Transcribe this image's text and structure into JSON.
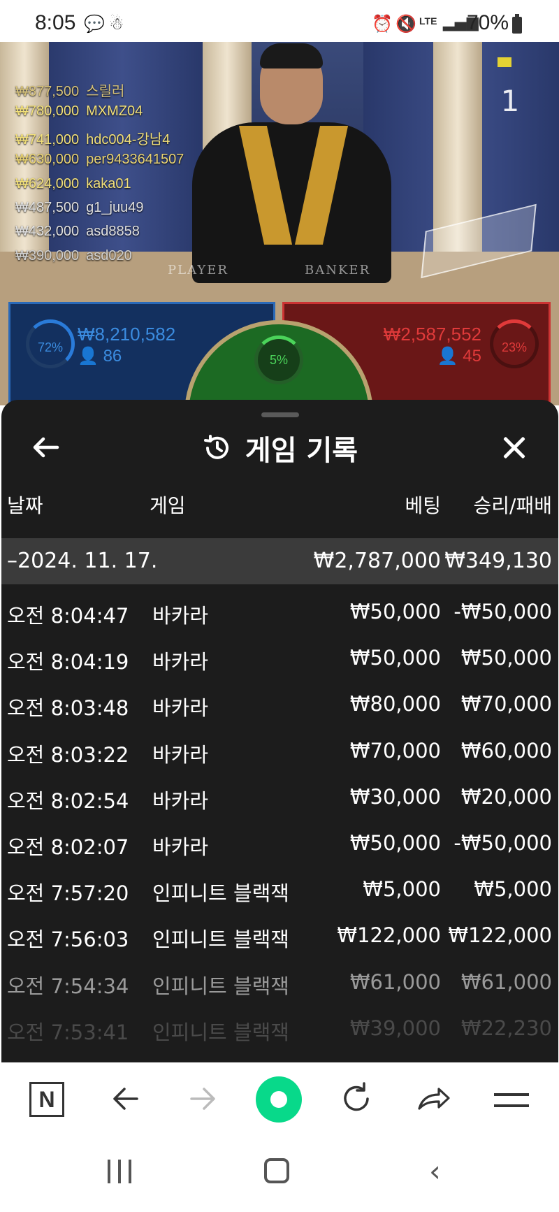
{
  "status_bar": {
    "time": "8:05",
    "battery": "70%",
    "icons": [
      "messenger-icon",
      "snapchat-icon",
      "alarm-icon",
      "mute-icon",
      "lte-icon",
      "signal-icon",
      "battery-icon"
    ]
  },
  "video": {
    "round_number": "1",
    "table_labels": {
      "player": "PLAYER",
      "banker": "BANKER"
    },
    "winners": [
      {
        "amount": "₩877,500",
        "name": "스릴러",
        "color": "#d6c27a"
      },
      {
        "amount": "₩780,000",
        "name": "MXMZ04",
        "color": "#f2e07a"
      },
      {
        "amount": "₩741,000",
        "name": "hdc004-강남4",
        "color": "#f2e07a"
      },
      {
        "amount": "₩630,000",
        "name": "per9433641507",
        "color": "#e8d272"
      },
      {
        "amount": "₩624,000",
        "name": "kaka01",
        "color": "#f2e07a"
      },
      {
        "amount": "₩487,500",
        "name": "g1_juu49",
        "color": "#e0e0e0"
      },
      {
        "amount": "₩432,000",
        "name": "asd8858",
        "color": "#e0e0e0"
      },
      {
        "amount": "₩390,000",
        "name": "asd020",
        "color": "#d0d0d0"
      }
    ],
    "player_bets": {
      "percent": "72%",
      "amount": "₩8,210,582",
      "players": "86",
      "color": "#2a7bd9"
    },
    "banker_bets": {
      "percent": "23%",
      "amount": "₩2,587,552",
      "players": "45",
      "color": "#e03a3a"
    },
    "tie_bets": {
      "percent": "5%",
      "color": "#4bd45a"
    }
  },
  "sheet": {
    "title": "게임 기록",
    "columns": {
      "date": "날짜",
      "game": "게임",
      "bet": "베팅",
      "result": "승리/패배"
    },
    "group": {
      "date": "–2024. 11. 17.",
      "bet_total": "₩2,787,000",
      "result_total": "₩349,130"
    },
    "rows": [
      {
        "time": "오전 8:04:47",
        "game": "바카라",
        "bet": "₩50,000",
        "result": "-₩50,000"
      },
      {
        "time": "오전 8:04:19",
        "game": "바카라",
        "bet": "₩50,000",
        "result": "₩50,000"
      },
      {
        "time": "오전 8:03:48",
        "game": "바카라",
        "bet": "₩80,000",
        "result": "₩70,000"
      },
      {
        "time": "오전 8:03:22",
        "game": "바카라",
        "bet": "₩70,000",
        "result": "₩60,000"
      },
      {
        "time": "오전 8:02:54",
        "game": "바카라",
        "bet": "₩30,000",
        "result": "₩20,000"
      },
      {
        "time": "오전 8:02:07",
        "game": "바카라",
        "bet": "₩50,000",
        "result": "-₩50,000"
      },
      {
        "time": "오전 7:57:20",
        "game": "인피니트 블랙잭",
        "bet": "₩5,000",
        "result": "₩5,000"
      },
      {
        "time": "오전 7:56:03",
        "game": "인피니트 블랙잭",
        "bet": "₩122,000",
        "result": "₩122,000"
      },
      {
        "time": "오전 7:54:34",
        "game": "인피니트 블랙잭",
        "bet": "₩61,000",
        "result": "₩61,000"
      },
      {
        "time": "오전 7:53:41",
        "game": "인피니트 블랙잭",
        "bet": "₩39,000",
        "result": "₩22,230"
      }
    ]
  },
  "browser_toolbar": {
    "items": [
      "naver-n-icon",
      "back-arrow-icon",
      "forward-arrow-icon",
      "home-green-icon",
      "refresh-icon",
      "share-icon",
      "menu-icon"
    ],
    "accent": "#08d98a"
  },
  "android_nav": {
    "items": [
      "recent-apps-icon",
      "home-icon",
      "back-icon"
    ]
  }
}
